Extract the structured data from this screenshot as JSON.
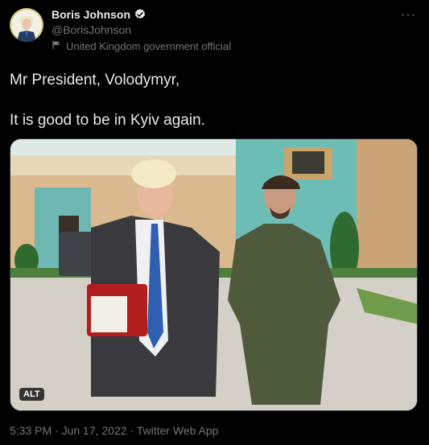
{
  "author": {
    "name": "Boris Johnson",
    "handle": "@BorisJohnson",
    "label": "United Kingdom government official",
    "verified": true
  },
  "tweet": {
    "text": "Mr President, Volodymyr,\n\nIt is good to be in Kyiv again.",
    "alt_badge": "ALT",
    "timestamp": "5:33 PM · Jun 17, 2022 · Twitter Web App"
  },
  "icons": {
    "more": "more-options-icon",
    "verified": "verified-badge-icon",
    "label": "flag-icon"
  },
  "colors": {
    "background": "#000000",
    "text": "#e7e9ea",
    "secondary": "#71767b",
    "accent": "#1d9bf0"
  }
}
